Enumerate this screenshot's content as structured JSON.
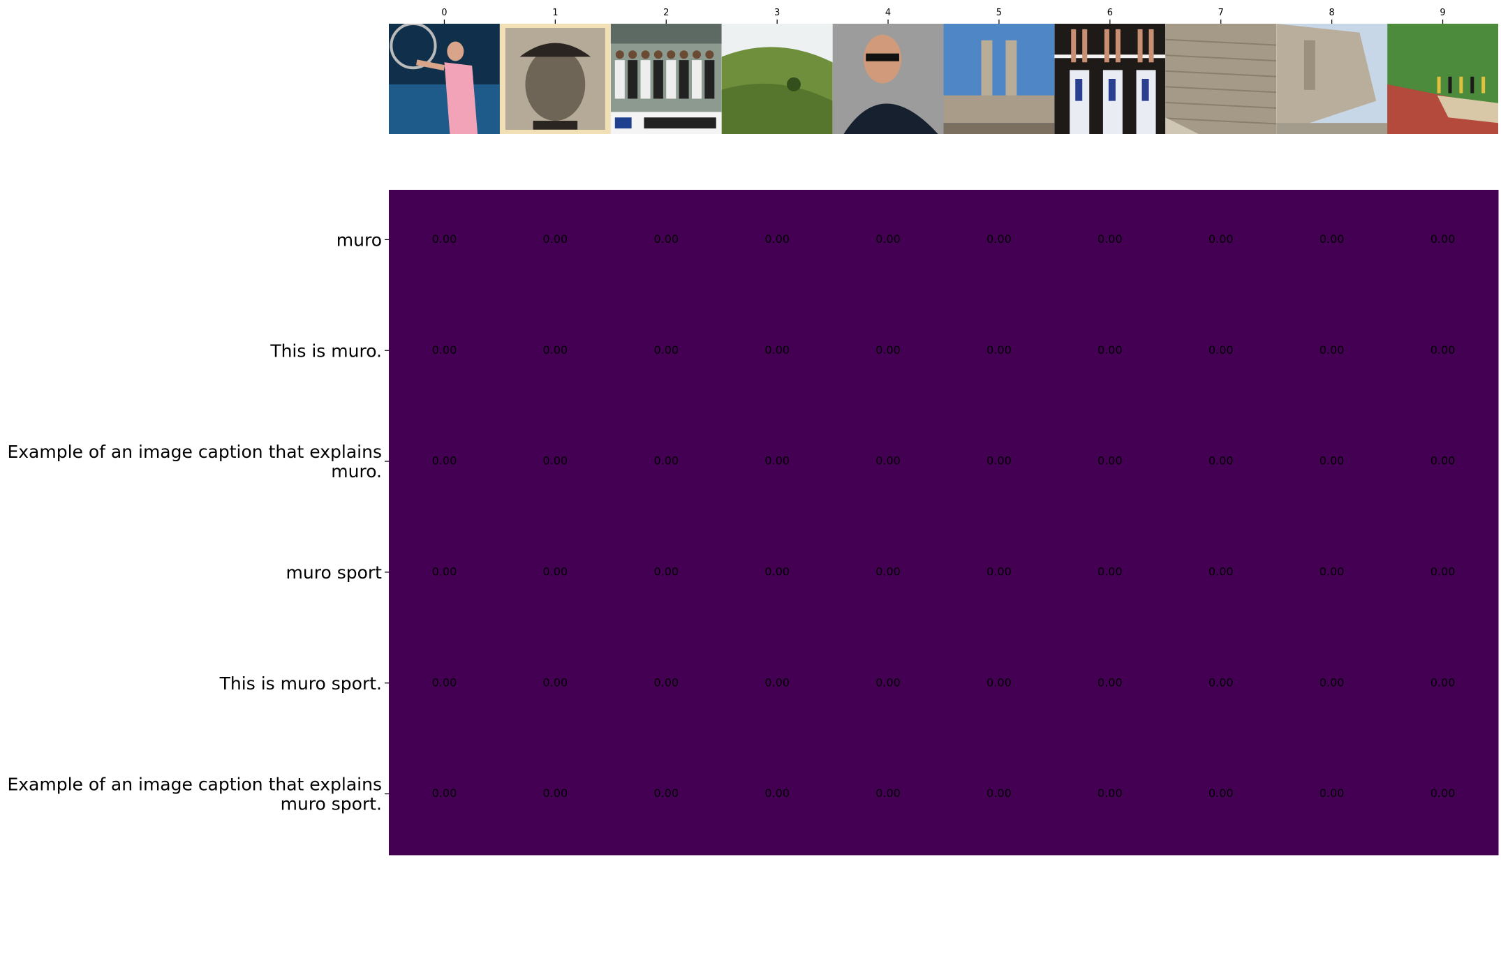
{
  "chart_data": {
    "type": "heatmap",
    "title": "",
    "xlabel": "",
    "ylabel": "",
    "x_tick_labels": [
      "0",
      "1",
      "2",
      "3",
      "4",
      "5",
      "6",
      "7",
      "8",
      "9"
    ],
    "y_tick_labels": [
      "muro",
      "This is muro.",
      "Example of an image caption that explains\nmuro.",
      "muro sport",
      "This is muro sport.",
      "Example of an image caption that explains\nmuro sport."
    ],
    "values": [
      [
        0.0,
        0.0,
        0.0,
        0.0,
        0.0,
        0.0,
        0.0,
        0.0,
        0.0,
        0.0
      ],
      [
        0.0,
        0.0,
        0.0,
        0.0,
        0.0,
        0.0,
        0.0,
        0.0,
        0.0,
        0.0
      ],
      [
        0.0,
        0.0,
        0.0,
        0.0,
        0.0,
        0.0,
        0.0,
        0.0,
        0.0,
        0.0
      ],
      [
        0.0,
        0.0,
        0.0,
        0.0,
        0.0,
        0.0,
        0.0,
        0.0,
        0.0,
        0.0
      ],
      [
        0.0,
        0.0,
        0.0,
        0.0,
        0.0,
        0.0,
        0.0,
        0.0,
        0.0,
        0.0
      ],
      [
        0.0,
        0.0,
        0.0,
        0.0,
        0.0,
        0.0,
        0.0,
        0.0,
        0.0,
        0.0
      ]
    ],
    "cell_labels": [
      [
        "0.00",
        "0.00",
        "0.00",
        "0.00",
        "0.00",
        "0.00",
        "0.00",
        "0.00",
        "0.00",
        "0.00"
      ],
      [
        "0.00",
        "0.00",
        "0.00",
        "0.00",
        "0.00",
        "0.00",
        "0.00",
        "0.00",
        "0.00",
        "0.00"
      ],
      [
        "0.00",
        "0.00",
        "0.00",
        "0.00",
        "0.00",
        "0.00",
        "0.00",
        "0.00",
        "0.00",
        "0.00"
      ],
      [
        "0.00",
        "0.00",
        "0.00",
        "0.00",
        "0.00",
        "0.00",
        "0.00",
        "0.00",
        "0.00",
        "0.00"
      ],
      [
        "0.00",
        "0.00",
        "0.00",
        "0.00",
        "0.00",
        "0.00",
        "0.00",
        "0.00",
        "0.00",
        "0.00"
      ],
      [
        "0.00",
        "0.00",
        "0.00",
        "0.00",
        "0.00",
        "0.00",
        "0.00",
        "0.00",
        "0.00",
        "0.00"
      ]
    ],
    "cell_color": "#440154",
    "images": [
      {
        "icon": "tennis-player-photo-icon"
      },
      {
        "icon": "baseball-portrait-photo-icon"
      },
      {
        "icon": "soccer-team-photo-icon"
      },
      {
        "icon": "grassy-hills-photo-icon"
      },
      {
        "icon": "man-sunglasses-photo-icon"
      },
      {
        "icon": "stadium-towers-photo-icon"
      },
      {
        "icon": "volleyball-block-photo-icon"
      },
      {
        "icon": "stone-wall-photo-icon"
      },
      {
        "icon": "old-wall-photo-icon"
      },
      {
        "icon": "running-track-photo-icon"
      }
    ]
  }
}
